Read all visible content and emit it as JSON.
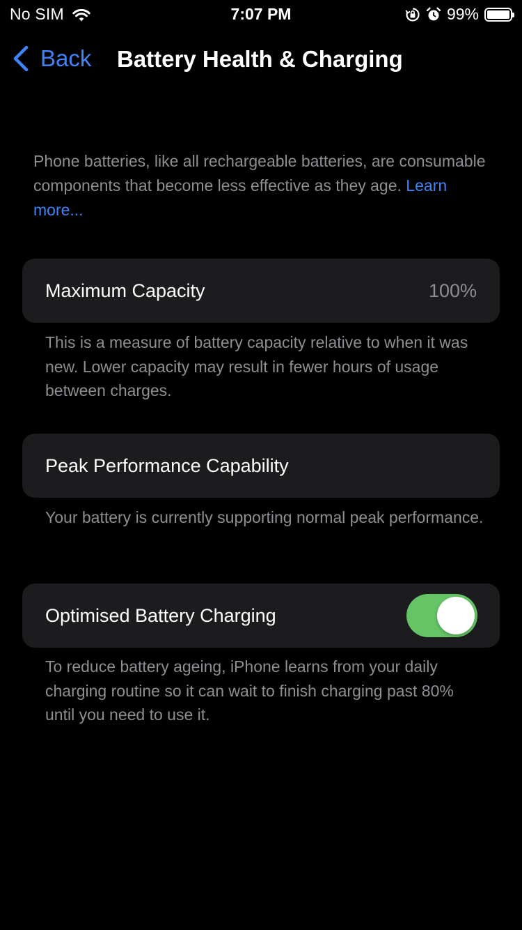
{
  "status_bar": {
    "carrier": "No SIM",
    "time": "7:07 PM",
    "battery_percent": "99%",
    "battery_level": 0.99,
    "icons": [
      "wifi-icon",
      "orientation-lock-icon",
      "alarm-icon",
      "battery-icon"
    ]
  },
  "nav": {
    "back_label": "Back",
    "title": "Battery Health & Charging"
  },
  "intro": {
    "text": "Phone batteries, like all rechargeable batteries, are consumable components that become less effective as they age. ",
    "link": "Learn more..."
  },
  "maximum_capacity": {
    "label": "Maximum Capacity",
    "value": "100%",
    "footnote": "This is a measure of battery capacity relative to when it was new. Lower capacity may result in fewer hours of usage between charges."
  },
  "peak_performance": {
    "label": "Peak Performance Capability",
    "footnote": "Your battery is currently supporting normal peak performance."
  },
  "optimised_charging": {
    "label": "Optimised Battery Charging",
    "enabled": true,
    "footnote": "To reduce battery ageing, iPhone learns from your daily charging routine so it can wait to finish charging past 80% until you need to use it."
  },
  "colors": {
    "background": "#000000",
    "cell_background": "#1c1c1e",
    "accent": "#3f83f8",
    "secondary_text": "#8e8e93",
    "toggle_on": "#65c466"
  }
}
